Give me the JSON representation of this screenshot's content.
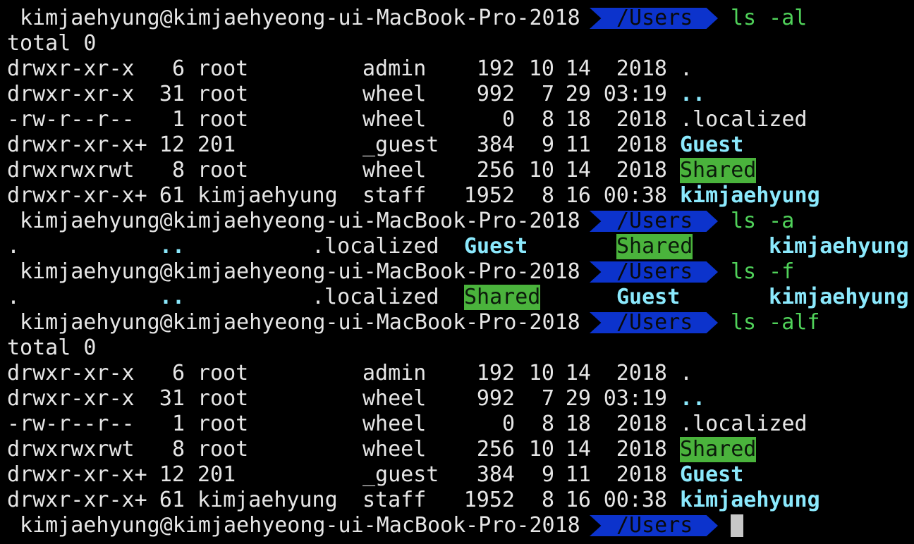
{
  "terminal": {
    "cursor_visible": true,
    "colors": {
      "background": "#000000",
      "text": "#e6e6e6",
      "directory": "#8be9fd",
      "highlight_bg": "#4ab33c",
      "prompt_segment_bg": "#0c33cc",
      "command": "#50d25a"
    },
    "prompt": {
      "user_host": "kimjaehyung@kimjaehyeong-ui-MacBook-Pro-2018",
      "path": "/Users"
    },
    "blocks": [
      {
        "command": "ls -al",
        "total": "total 0",
        "rows": [
          {
            "perms": "drwxr-xr-x",
            "links": "6",
            "owner": "root",
            "group": "admin",
            "size": "192",
            "month": "10",
            "day": "14",
            "time": "2018",
            "name": ".",
            "kind": "plain"
          },
          {
            "perms": "drwxr-xr-x",
            "links": "31",
            "owner": "root",
            "group": "wheel",
            "size": "992",
            "month": "7",
            "day": "29",
            "time": "03:19",
            "name": "..",
            "kind": "dir"
          },
          {
            "perms": "-rw-r--r--",
            "links": "1",
            "owner": "root",
            "group": "wheel",
            "size": "0",
            "month": "8",
            "day": "18",
            "time": "2018",
            "name": ".localized",
            "kind": "plain"
          },
          {
            "perms": "drwxr-xr-x+",
            "links": "12",
            "owner": "201",
            "group": "_guest",
            "size": "384",
            "month": "9",
            "day": "11",
            "time": "2018",
            "name": "Guest",
            "kind": "dir"
          },
          {
            "perms": "drwxrwxrwt",
            "links": "8",
            "owner": "root",
            "group": "wheel",
            "size": "256",
            "month": "10",
            "day": "14",
            "time": "2018",
            "name": "Shared",
            "kind": "highlight"
          },
          {
            "perms": "drwxr-xr-x+",
            "links": "61",
            "owner": "kimjaehyung",
            "group": "staff",
            "size": "1952",
            "month": "8",
            "day": "16",
            "time": "00:38",
            "name": "kimjaehyung",
            "kind": "dir"
          }
        ]
      },
      {
        "command": "ls -a",
        "entries": [
          {
            "name": ".",
            "kind": "plain"
          },
          {
            "name": "..",
            "kind": "dir"
          },
          {
            "name": ".localized",
            "kind": "plain"
          },
          {
            "name": "Guest",
            "kind": "dir"
          },
          {
            "name": "Shared",
            "kind": "highlight"
          },
          {
            "name": "kimjaehyung",
            "kind": "dir"
          }
        ]
      },
      {
        "command": "ls -f",
        "entries": [
          {
            "name": ".",
            "kind": "plain"
          },
          {
            "name": "..",
            "kind": "dir"
          },
          {
            "name": ".localized",
            "kind": "plain"
          },
          {
            "name": "Shared",
            "kind": "highlight"
          },
          {
            "name": "Guest",
            "kind": "dir"
          },
          {
            "name": "kimjaehyung",
            "kind": "dir"
          }
        ]
      },
      {
        "command": "ls -alf",
        "total": "total 0",
        "rows": [
          {
            "perms": "drwxr-xr-x",
            "links": "6",
            "owner": "root",
            "group": "admin",
            "size": "192",
            "month": "10",
            "day": "14",
            "time": "2018",
            "name": ".",
            "kind": "plain"
          },
          {
            "perms": "drwxr-xr-x",
            "links": "31",
            "owner": "root",
            "group": "wheel",
            "size": "992",
            "month": "7",
            "day": "29",
            "time": "03:19",
            "name": "..",
            "kind": "dir"
          },
          {
            "perms": "-rw-r--r--",
            "links": "1",
            "owner": "root",
            "group": "wheel",
            "size": "0",
            "month": "8",
            "day": "18",
            "time": "2018",
            "name": ".localized",
            "kind": "plain"
          },
          {
            "perms": "drwxrwxrwt",
            "links": "8",
            "owner": "root",
            "group": "wheel",
            "size": "256",
            "month": "10",
            "day": "14",
            "time": "2018",
            "name": "Shared",
            "kind": "highlight"
          },
          {
            "perms": "drwxr-xr-x+",
            "links": "12",
            "owner": "201",
            "group": "_guest",
            "size": "384",
            "month": "9",
            "day": "11",
            "time": "2018",
            "name": "Guest",
            "kind": "dir"
          },
          {
            "perms": "drwxr-xr-x+",
            "links": "61",
            "owner": "kimjaehyung",
            "group": "staff",
            "size": "1952",
            "month": "8",
            "day": "16",
            "time": "00:38",
            "name": "kimjaehyung",
            "kind": "dir"
          }
        ]
      }
    ]
  }
}
